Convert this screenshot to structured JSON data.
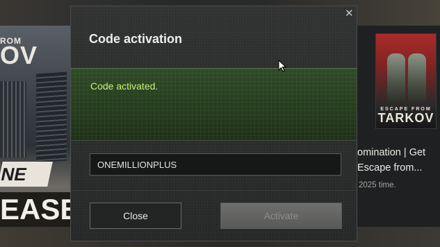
{
  "dialog": {
    "title": "Code activation",
    "status_message": "Code activated.",
    "code_value": "ONEMILLIONPLUS",
    "close_label": "Close",
    "activate_label": "Activate",
    "status_color": "#c6f07c"
  },
  "background": {
    "close_icon": "close-icon",
    "banner_logo_small": "ROM",
    "banner_logo": "OV",
    "banner_word1": "NE",
    "banner_word2": "EASE",
    "poster_small": "ESCAPE FROM",
    "poster_title": "TARKOV",
    "news_title": "omination | Get\nEscape from...",
    "news_meta": "2025 time."
  }
}
